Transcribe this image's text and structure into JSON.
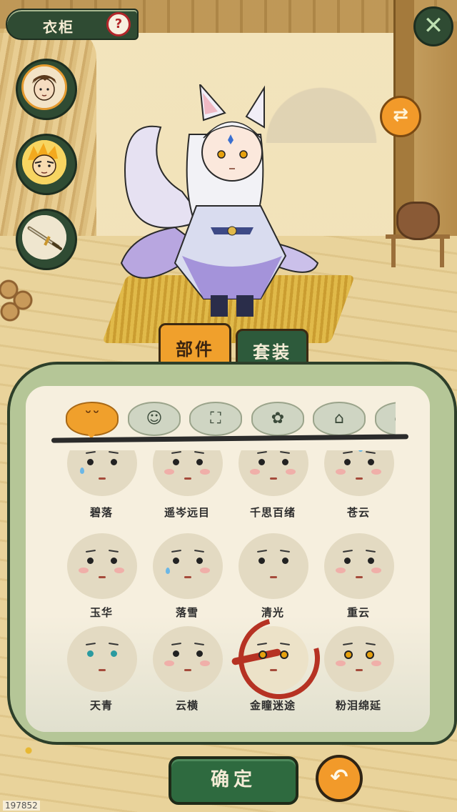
{
  "header": {
    "title": "衣柜",
    "help_symbol": "?",
    "close_symbol": "✕"
  },
  "characters": [
    {
      "name": "boy-avatar",
      "selected": true
    },
    {
      "name": "golden-monkey-avatar",
      "selected": false
    },
    {
      "name": "sword-avatar",
      "selected": false
    }
  ],
  "switch_symbol": "⇄",
  "tabs": {
    "parts": "部件",
    "suits": "套装",
    "active": "parts"
  },
  "categories": [
    {
      "icon": "face-icon",
      "glyph": "˘˘",
      "active": true
    },
    {
      "icon": "hair-icon",
      "glyph": "☺",
      "active": false
    },
    {
      "icon": "clothes-icon",
      "glyph": "⛶",
      "active": false
    },
    {
      "icon": "flower-icon",
      "glyph": "✿",
      "active": false
    },
    {
      "icon": "cape-icon",
      "glyph": "⌂",
      "active": false
    },
    {
      "icon": "more-icon",
      "glyph": "◐",
      "active": false
    }
  ],
  "items": [
    {
      "label": "碧落"
    },
    {
      "label": "遥岑远目"
    },
    {
      "label": "千思百绪"
    },
    {
      "label": "苍云"
    },
    {
      "label": "玉华"
    },
    {
      "label": "落雪"
    },
    {
      "label": "清光"
    },
    {
      "label": "重云"
    },
    {
      "label": "天青"
    },
    {
      "label": "云横"
    },
    {
      "label": "金瞳迷途",
      "selected": true
    },
    {
      "label": "粉泪绵延"
    }
  ],
  "footer": {
    "confirm": "确定",
    "back_symbol": "↶"
  },
  "watermark": "197852",
  "colors": {
    "accent": "#f0a02c",
    "dark_green": "#2e6a3f",
    "panel_green": "#b5c697",
    "ring_red": "#b63223"
  }
}
